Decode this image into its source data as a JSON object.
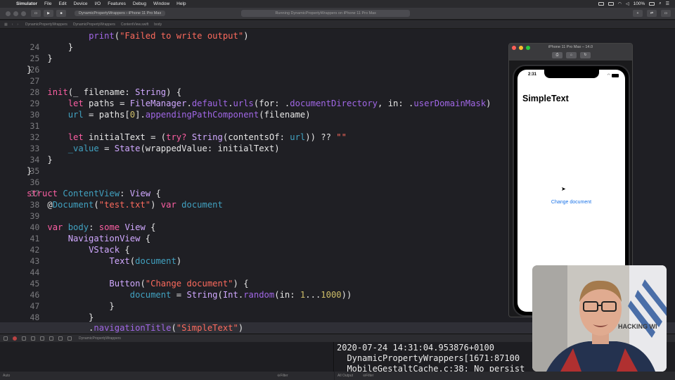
{
  "menubar": {
    "items": [
      "Simulator",
      "File",
      "Edit",
      "Device",
      "I/O",
      "Features",
      "Debug",
      "Window",
      "Help"
    ],
    "battery": "100%"
  },
  "toolbar": {
    "scheme": "DynamicPropertyWrappers",
    "device": "iPhone 11 Pro Max",
    "activity": "Running DynamicPropertyWrappers on iPhone 11 Pro Max"
  },
  "jumpbar": {
    "crumbs": [
      "DynamicPropertyWrappers",
      "DynamicPropertyWrappers",
      "ContentView.swift",
      "body"
    ]
  },
  "editor": {
    "current_line": 50,
    "lines": [
      {
        "n": "24",
        "code": "            print(\"Failed to write output\")"
      },
      {
        "n": "25",
        "code": "        }"
      },
      {
        "n": "26",
        "code": "    }"
      },
      {
        "n": "27",
        "code": "}"
      },
      {
        "n": "28",
        "code": ""
      },
      {
        "n": "29",
        "code": "init(_ filename: String) {"
      },
      {
        "n": "30",
        "code": "let paths = FileManager.default.urls(for: .documentDirectory, in: .userDomainMask)"
      },
      {
        "n": "31",
        "code": "url = paths[0].appendingPathComponent(filename)"
      },
      {
        "n": "32",
        "code": ""
      },
      {
        "n": "33",
        "code": "let initialText = (try? String(contentsOf: url)) ?? \"\""
      },
      {
        "n": "34",
        "code": "_value = State(wrappedValue: initialText)"
      },
      {
        "n": "35",
        "code": "}"
      },
      {
        "n": "36",
        "code": "}"
      },
      {
        "n": "37",
        "code": ""
      },
      {
        "n": "38",
        "code": "struct ContentView: View {"
      },
      {
        "n": "39",
        "code": "@Document(\"test.txt\") var document"
      },
      {
        "n": "40",
        "code": ""
      },
      {
        "n": "41",
        "code": "var body: some View {"
      },
      {
        "n": "42",
        "code": "NavigationView {"
      },
      {
        "n": "43",
        "code": "VStack {"
      },
      {
        "n": "44",
        "code": "Text(document)"
      },
      {
        "n": "45",
        "code": ""
      },
      {
        "n": "46",
        "code": "Button(\"Change document\") {"
      },
      {
        "n": "47",
        "code": "document = String(Int.random(in: 1...1000))"
      },
      {
        "n": "48",
        "code": "}"
      },
      {
        "n": "49",
        "code": "}"
      },
      {
        "n": "50",
        "code": ".navigationTitle(\"SimpleText\")"
      }
    ]
  },
  "debug": {
    "target": "DynamicPropertyWrappers",
    "vars_scope": "Auto",
    "vars_filter": "Filter",
    "console_scope": "All Output",
    "console_filter": "Filter",
    "console_lines": [
      "2020-07-24 14:31:04.953876+0100",
      "  DynamicPropertyWrappers[1671:87100",
      "  MobileGestaltCache.c:38: No persist"
    ]
  },
  "simulator": {
    "window_title": "iPhone 11 Pro Max – 14.0",
    "time": "2:31",
    "nav_title": "SimpleText",
    "button_label": "Change document"
  },
  "webcam": {
    "sign_text": "HACKING WI"
  }
}
